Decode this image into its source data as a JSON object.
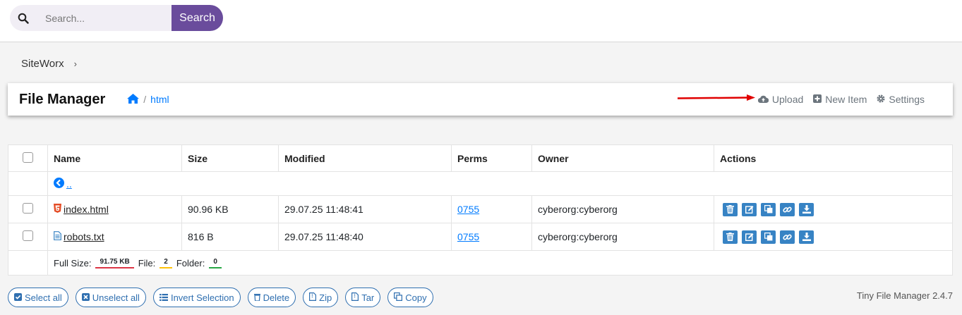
{
  "search": {
    "placeholder": "Search...",
    "button_label": "Search"
  },
  "breadcrumb": {
    "root": "SiteWorx"
  },
  "header": {
    "title": "File Manager",
    "path": "html",
    "actions": {
      "upload": "Upload",
      "new_item": "New Item",
      "settings": "Settings"
    }
  },
  "table": {
    "columns": {
      "name": "Name",
      "size": "Size",
      "modified": "Modified",
      "perms": "Perms",
      "owner": "Owner",
      "actions": "Actions"
    },
    "up_label": "..",
    "files": [
      {
        "name": " index.html",
        "size": "90.96 KB",
        "modified": "29.07.25 11:48:41",
        "perms": "0755",
        "owner": "cyberorg:cyberorg",
        "icon": "html5-icon"
      },
      {
        "name": " robots.txt",
        "size": "816 B",
        "modified": "29.07.25 11:48:40",
        "perms": "0755",
        "owner": "cyberorg:cyberorg",
        "icon": "text-file-icon"
      }
    ],
    "summary": {
      "full_size_label": "Full Size:",
      "full_size": "91.75 KB",
      "file_label": "File:",
      "file_count": "2",
      "folder_label": "Folder:",
      "folder_count": "0"
    }
  },
  "bottom_buttons": {
    "select_all": "Select all",
    "unselect_all": "Unselect all",
    "invert": "Invert Selection",
    "delete": "Delete",
    "zip": "Zip",
    "tar": "Tar",
    "copy": "Copy"
  },
  "version": "Tiny File Manager 2.4.7",
  "colors": {
    "accent": "#6a4c9c",
    "link": "#007bff",
    "action_button": "#3783c4",
    "annotation_arrow": "#e00000"
  }
}
